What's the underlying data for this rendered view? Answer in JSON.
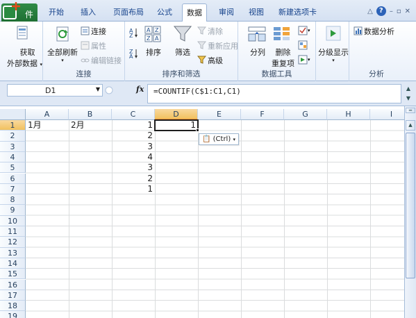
{
  "tabs": {
    "file": "件",
    "items": [
      "开始",
      "插入",
      "页面布局",
      "公式",
      "数据",
      "审阅",
      "视图",
      "新建选项卡"
    ],
    "active": "数据"
  },
  "window": {
    "help": "?",
    "minimize": "–",
    "restore": "▫",
    "close": "✕",
    "collapse": "△"
  },
  "ribbon": {
    "connections": {
      "get_external_line1": "获取",
      "get_external_line2": "外部数据",
      "refresh_all": "全部刷新",
      "connections": "连接",
      "properties": "属性",
      "edit_links": "编辑链接",
      "label": "连接"
    },
    "sort_filter": {
      "sort": "排序",
      "filter": "筛选",
      "clear": "清除",
      "reapply": "重新应用",
      "advanced": "高级",
      "label": "排序和筛选"
    },
    "data_tools": {
      "text_to_columns": "分列",
      "remove_duplicates_line1": "删除",
      "remove_duplicates_line2": "重复项",
      "label": "数据工具"
    },
    "outline": {
      "group": "分级显示"
    },
    "analysis": {
      "data_analysis": "数据分析",
      "label": "分析"
    }
  },
  "formula_bar": {
    "name_box": "D1",
    "fx": "fx",
    "formula": "=COUNTIF(C$1:C1,C1)"
  },
  "sheet": {
    "columns": [
      "A",
      "B",
      "C",
      "D",
      "E",
      "F",
      "G",
      "H",
      "I"
    ],
    "selected_column": "D",
    "rows": [
      "1",
      "2",
      "3",
      "4",
      "5",
      "6",
      "7",
      "8",
      "9",
      "10",
      "11",
      "12",
      "13",
      "14",
      "15",
      "16",
      "17",
      "18",
      "19"
    ],
    "selected_row": "1",
    "cells": {
      "A1": "1月",
      "B1": "2月",
      "C1": "1",
      "C2": "2",
      "C3": "3",
      "C4": "4",
      "C5": "3",
      "C6": "2",
      "C7": "1",
      "D1": "1"
    },
    "paste_options": "(Ctrl)"
  },
  "colors": {
    "accent": "#2b579a",
    "file_tab": "#1e6f33",
    "selection_header": "#f1c15f"
  }
}
